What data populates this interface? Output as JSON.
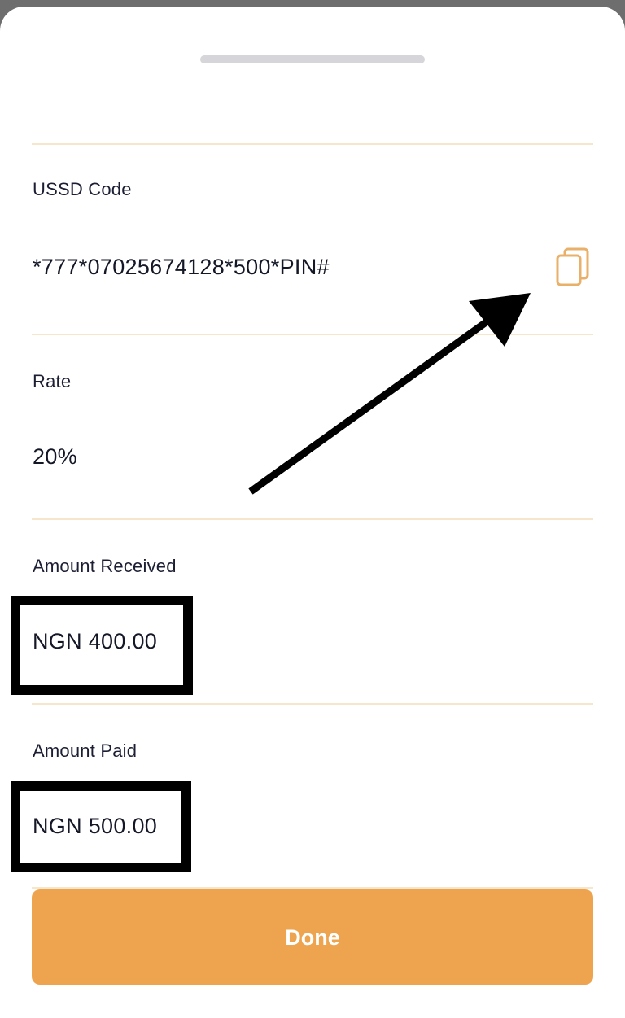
{
  "ussd": {
    "label": "USSD Code",
    "value": "*777*07025674128*500*PIN#",
    "copy_icon": "copy-icon"
  },
  "rate": {
    "label": "Rate",
    "value": "20%"
  },
  "amount_received": {
    "label": "Amount Received",
    "value": "NGN 400.00"
  },
  "amount_paid": {
    "label": "Amount Paid",
    "value": "NGN 500.00"
  },
  "done_button": {
    "label": "Done"
  },
  "colors": {
    "accent": "#eea44e",
    "divider": "#f6e6cc",
    "copy_icon": "#e9b06a"
  }
}
